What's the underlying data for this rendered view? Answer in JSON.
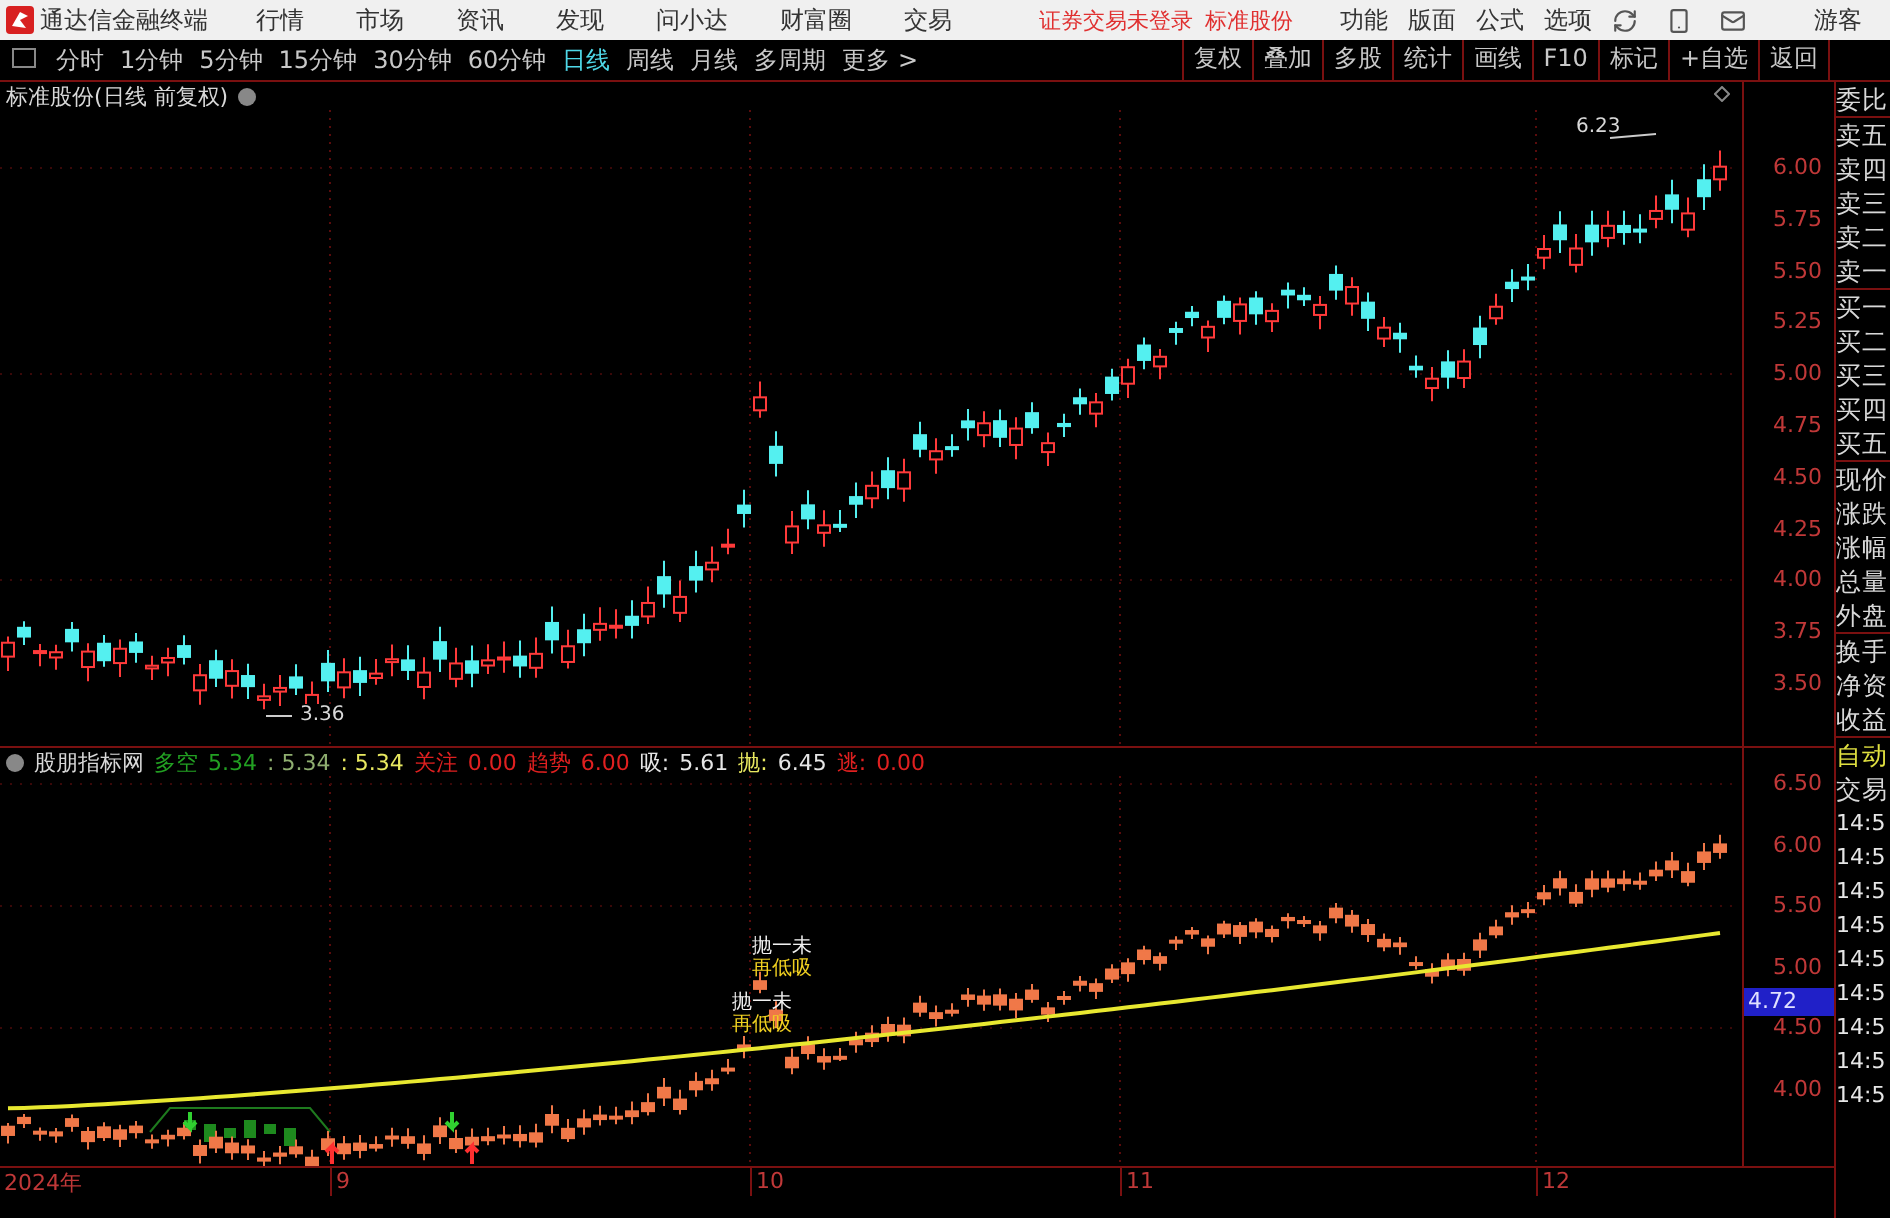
{
  "app": {
    "name": "通达信金融终端",
    "menus": [
      "行情",
      "市场",
      "资讯",
      "发现",
      "问小达",
      "财富圈",
      "交易"
    ],
    "status": [
      "证券交易未登录",
      "标准股份"
    ],
    "right_menus": [
      "功能",
      "版面",
      "公式",
      "选项"
    ],
    "user": "游客"
  },
  "periods": [
    {
      "label": "分时",
      "selected": false
    },
    {
      "label": "1分钟",
      "selected": false
    },
    {
      "label": "5分钟",
      "selected": false
    },
    {
      "label": "15分钟",
      "selected": false
    },
    {
      "label": "30分钟",
      "selected": false
    },
    {
      "label": "60分钟",
      "selected": false
    },
    {
      "label": "日线",
      "selected": true
    },
    {
      "label": "周线",
      "selected": false
    },
    {
      "label": "月线",
      "selected": false
    },
    {
      "label": "多周期",
      "selected": false
    },
    {
      "label": "更多 >",
      "selected": false
    }
  ],
  "tools": [
    "复权",
    "叠加",
    "多股",
    "统计",
    "画线",
    "F10",
    "标记",
    "+自选",
    "返回"
  ],
  "price_chart": {
    "title": "标准股份(日线 前复权)",
    "yticks": [
      "6.00",
      "5.75",
      "5.50",
      "5.25",
      "5.00",
      "4.75",
      "4.50",
      "4.25",
      "4.00",
      "3.75",
      "3.50"
    ],
    "annotations": [
      "6.23",
      "3.36"
    ]
  },
  "indicator": {
    "name": "股朋指标网",
    "readouts": [
      {
        "text": "多空",
        "color": "#22a022"
      },
      {
        "text": "5.34",
        "color": "#22a022"
      },
      {
        "text": ": 5.34",
        "color": "#8fae70"
      },
      {
        "text": ": 5.34",
        "color": "#e8e860"
      },
      {
        "text": "关注",
        "color": "#e02020"
      },
      {
        "text": "0.00",
        "color": "#e02020"
      },
      {
        "text": "趋势",
        "color": "#e02020"
      },
      {
        "text": "6.00",
        "color": "#e02020"
      },
      {
        "text": "吸:",
        "color": "#e6e6e6"
      },
      {
        "text": "5.61",
        "color": "#e6e6e6"
      },
      {
        "text": "抛:",
        "color": "#e8e860"
      },
      {
        "text": "6.45",
        "color": "#e6e6e6"
      },
      {
        "text": "逃:",
        "color": "#e02020"
      },
      {
        "text": "0.00",
        "color": "#e02020"
      }
    ],
    "yticks": [
      "6.50",
      "6.00",
      "5.50",
      "5.00",
      "4.50",
      "4.00"
    ],
    "marker": "4.72",
    "annotations": [
      "抛一未",
      "再低吸",
      "抛一未",
      "再低吸"
    ]
  },
  "x_axis": [
    "2024年",
    "9",
    "10",
    "11",
    "12"
  ],
  "quote_labels": [
    "委比",
    "卖五",
    "卖四",
    "卖三",
    "卖二",
    "卖一",
    "买一",
    "买二",
    "买三",
    "买四",
    "买五",
    "现价",
    "涨跌",
    "涨幅",
    "总量",
    "外盘",
    "换手",
    "净资",
    "收益"
  ],
  "auto_labels": [
    "自动",
    "交易"
  ],
  "times": [
    "14:5",
    "14:5",
    "14:5",
    "14:5",
    "14:5",
    "14:5",
    "14:5",
    "14:5",
    "14:5"
  ]
}
